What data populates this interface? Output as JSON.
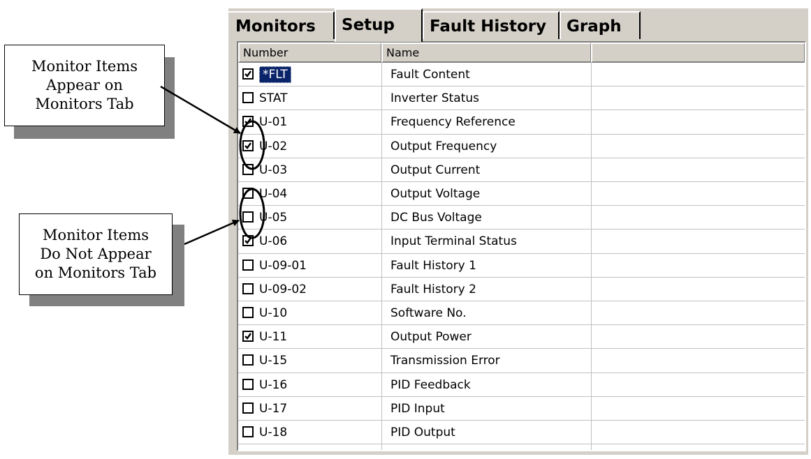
{
  "tabs": [
    {
      "label": "Monitors",
      "active": false
    },
    {
      "label": "Setup",
      "active": true
    },
    {
      "label": "Fault History",
      "active": false
    },
    {
      "label": "Graph",
      "active": false
    }
  ],
  "list": {
    "columns": [
      "Number",
      "Name",
      ""
    ],
    "rows": [
      {
        "number": "*FLT",
        "name": "Fault Content",
        "checked": true,
        "selected": true
      },
      {
        "number": "STAT",
        "name": "Inverter Status",
        "checked": false
      },
      {
        "number": "U-01",
        "name": "Frequency Reference",
        "checked": true
      },
      {
        "number": "U-02",
        "name": "Output Frequency",
        "checked": true
      },
      {
        "number": "U-03",
        "name": "Output Current",
        "checked": false
      },
      {
        "number": "U-04",
        "name": "Output Voltage",
        "checked": false
      },
      {
        "number": "U-05",
        "name": "DC Bus Voltage",
        "checked": false
      },
      {
        "number": "U-06",
        "name": "Input Terminal Status",
        "checked": true
      },
      {
        "number": "U-09-01",
        "name": "Fault History 1",
        "checked": false
      },
      {
        "number": "U-09-02",
        "name": "Fault History 2",
        "checked": false
      },
      {
        "number": "U-10",
        "name": "Software No.",
        "checked": false
      },
      {
        "number": "U-11",
        "name": "Output Power",
        "checked": true
      },
      {
        "number": "U-15",
        "name": "Transmission Error",
        "checked": false
      },
      {
        "number": "U-16",
        "name": "PID Feedback",
        "checked": false
      },
      {
        "number": "U-17",
        "name": "PID Input",
        "checked": false
      },
      {
        "number": "U-18",
        "name": "PID Output",
        "checked": false
      }
    ]
  },
  "callouts": {
    "appear": [
      "Monitor Items",
      "Appear on",
      "Monitors Tab"
    ],
    "not_appear": [
      "Monitor Items",
      "Do Not Appear",
      "on Monitors Tab"
    ]
  }
}
